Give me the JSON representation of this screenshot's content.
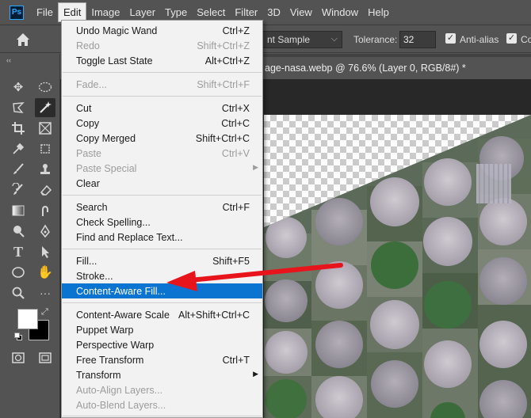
{
  "menubar": {
    "logo": "Ps",
    "items": [
      "File",
      "Edit",
      "Image",
      "Layer",
      "Type",
      "Select",
      "Filter",
      "3D",
      "View",
      "Window",
      "Help"
    ]
  },
  "options": {
    "sample_value": "nt Sample",
    "tolerance_label": "Tolerance:",
    "tolerance_value": "32",
    "antialias_label": "Anti-alias",
    "contiguous_label": "Co",
    "checked": "✓"
  },
  "toolbar": {
    "collapse": "‹‹"
  },
  "document": {
    "tab_title": "age-nasa.webp @ 76.6% (Layer 0, RGB/8#) *"
  },
  "edit_menu": {
    "undo": {
      "label": "Undo Magic Wand",
      "shortcut": "Ctrl+Z"
    },
    "redo": {
      "label": "Redo",
      "shortcut": "Shift+Ctrl+Z"
    },
    "toggle_last": {
      "label": "Toggle Last State",
      "shortcut": "Alt+Ctrl+Z"
    },
    "fade": {
      "label": "Fade...",
      "shortcut": "Shift+Ctrl+F"
    },
    "cut": {
      "label": "Cut",
      "shortcut": "Ctrl+X"
    },
    "copy": {
      "label": "Copy",
      "shortcut": "Ctrl+C"
    },
    "copy_merged": {
      "label": "Copy Merged",
      "shortcut": "Shift+Ctrl+C"
    },
    "paste": {
      "label": "Paste",
      "shortcut": "Ctrl+V"
    },
    "paste_special": {
      "label": "Paste Special"
    },
    "clear": {
      "label": "Clear"
    },
    "search": {
      "label": "Search",
      "shortcut": "Ctrl+F"
    },
    "check_spelling": {
      "label": "Check Spelling..."
    },
    "find_replace": {
      "label": "Find and Replace Text..."
    },
    "fill": {
      "label": "Fill...",
      "shortcut": "Shift+F5"
    },
    "stroke": {
      "label": "Stroke..."
    },
    "content_aware_fill": {
      "label": "Content-Aware Fill..."
    },
    "content_aware_scale": {
      "label": "Content-Aware Scale",
      "shortcut": "Alt+Shift+Ctrl+C"
    },
    "puppet_warp": {
      "label": "Puppet Warp"
    },
    "perspective_warp": {
      "label": "Perspective Warp"
    },
    "free_transform": {
      "label": "Free Transform",
      "shortcut": "Ctrl+T"
    },
    "transform": {
      "label": "Transform"
    },
    "auto_align": {
      "label": "Auto-Align Layers..."
    },
    "auto_blend": {
      "label": "Auto-Blend Layers..."
    }
  },
  "colors": {
    "highlight": "#0a74d0",
    "annotation_arrow": "#e8141c"
  }
}
